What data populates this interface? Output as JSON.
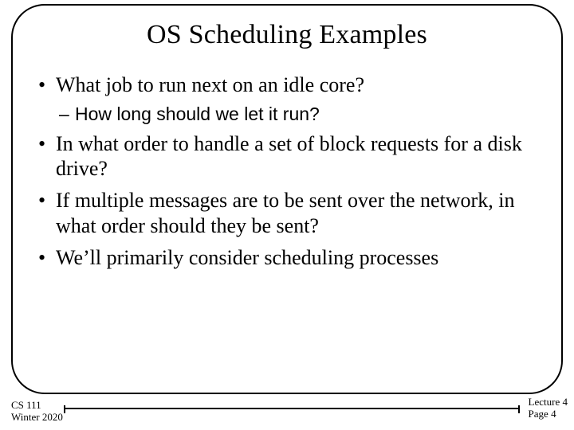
{
  "title": "OS Scheduling Examples",
  "bullets": [
    {
      "text": "What job to run next on an idle core?",
      "sub": [
        {
          "text": "How long should we let it run?"
        }
      ]
    },
    {
      "text": "In what order to handle a set of block requests for a disk drive?"
    },
    {
      "text": "If multiple messages are to be sent over the network, in what order should they be sent?"
    },
    {
      "text": "We’ll primarily consider scheduling processes"
    }
  ],
  "footer": {
    "course": "CS 111",
    "term": "Winter 2020",
    "lecture": "Lecture 4",
    "page": "Page 4"
  }
}
